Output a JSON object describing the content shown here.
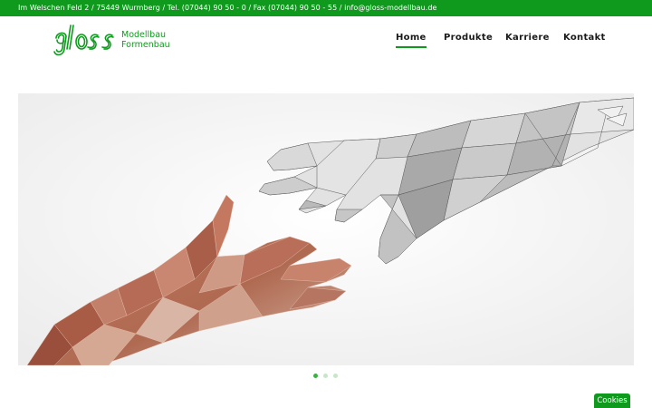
{
  "topbar": {
    "contact_line": "Im Welschen Feld 2 / 75449 Wurmberg / Tel. (07044) 90 50 - 0 / Fax (07044) 90 50 - 55 / info@gloss-modellbau.de"
  },
  "logo": {
    "word": "gloss",
    "line1": "Modellbau",
    "line2": "Formenbau"
  },
  "nav": {
    "items": [
      {
        "label": "Home",
        "active": true
      },
      {
        "label": "Produkte",
        "active": false
      },
      {
        "label": "Karriere",
        "active": false
      },
      {
        "label": "Kontakt",
        "active": false
      }
    ]
  },
  "slider": {
    "slide_count": 3,
    "active_slide": 1,
    "image": "low-poly-hands-reaching"
  },
  "cookies": {
    "label": "Cookies"
  },
  "colors": {
    "brand_green": "#0f9a1e",
    "dot_active": "#3cb043",
    "dot_inactive": "#c8e6c8"
  }
}
